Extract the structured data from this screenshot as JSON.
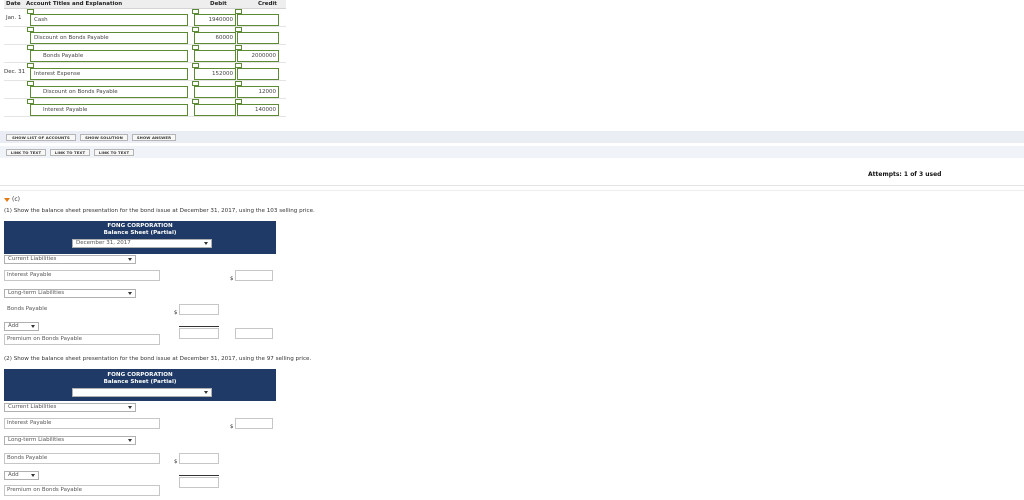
{
  "journal": {
    "headers": {
      "date": "Date",
      "account": "Account Titles and Explanation",
      "debit": "Debit",
      "credit": "Credit"
    },
    "dates": {
      "jan1": "Jan. 1",
      "dec31": "Dec. 31"
    },
    "entries": [
      {
        "account": "Cash",
        "debit": "1940000",
        "credit": ""
      },
      {
        "account": "Discount on Bonds Payable",
        "debit": "60000",
        "credit": ""
      },
      {
        "account": "Bonds Payable",
        "debit": "",
        "credit": "2000000"
      },
      {
        "account": "Interest Expense",
        "debit": "152000",
        "credit": ""
      },
      {
        "account": "Discount on Bonds Payable",
        "debit": "",
        "credit": "12000"
      },
      {
        "account": "Interest Payable",
        "debit": "",
        "credit": "140000"
      }
    ]
  },
  "buttons": {
    "show_list": "SHOW LIST OF ACCOUNTS",
    "show_solution": "SHOW SOLUTION",
    "show_answer": "SHOW ANSWER",
    "link1": "LINK TO TEXT",
    "link2": "LINK TO TEXT",
    "link3": "LINK TO TEXT"
  },
  "attempts": "Attempts: 1 of 3 used",
  "part_c": {
    "label": "(c)",
    "q1": "(1) Show the balance sheet presentation for the bond issue at December 31, 2017, using the 103 selling price.",
    "q2": "(2) Show the balance sheet presentation for the bond issue at December 31, 2017, using the 97 selling price.",
    "company": "FONG CORPORATION",
    "statement": "Balance Sheet (Partial)",
    "date_selected": "December 31, 2017",
    "date_empty": "",
    "current_liabilities": "Current Liabilities",
    "interest_payable": "Interest Payable",
    "long_term_liabilities": "Long-term Liabilities",
    "bonds_payable": "Bonds Payable",
    "add": "Add",
    "premium": "Premium on Bonds Payable",
    "dollar": "$"
  }
}
